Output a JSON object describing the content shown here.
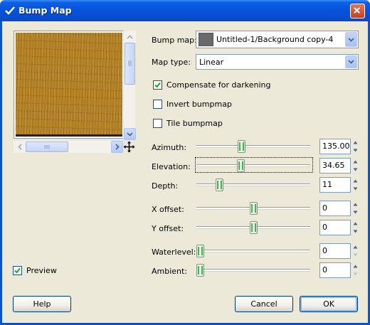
{
  "window": {
    "title": "Bump Map"
  },
  "preview": {
    "label": "Preview",
    "checked": true
  },
  "bump_map": {
    "label": "Bump map:",
    "value": "Untitled-1/Background copy-4"
  },
  "map_type": {
    "label": "Map type:",
    "value": "Linear"
  },
  "options": [
    {
      "label": "Compensate for darkening",
      "checked": true
    },
    {
      "label": "Invert bumpmap",
      "checked": false
    },
    {
      "label": "Tile bumpmap",
      "checked": false
    }
  ],
  "sliders": [
    {
      "label": "Azimuth:",
      "value": "135.00",
      "fraction": 0.39
    },
    {
      "label": "Elevation:",
      "value": "34.65",
      "fraction": 0.385
    },
    {
      "label": "Depth:",
      "value": "11",
      "fraction": 0.18
    },
    {
      "label": "X offset:",
      "value": "0",
      "fraction": 0.5
    },
    {
      "label": "Y offset:",
      "value": "0",
      "fraction": 0.5
    },
    {
      "label": "Waterlevel:",
      "value": "0",
      "fraction": 0.0
    },
    {
      "label": "Ambient:",
      "value": "0",
      "fraction": 0.0
    }
  ],
  "buttons": {
    "help": "Help",
    "cancel": "Cancel",
    "ok": "OK"
  },
  "colors": {
    "title_bar": "#0551d8",
    "dialog_bg": "#ece9d8",
    "slider_grip": "#3fb64b",
    "texture": "#b8862a"
  }
}
